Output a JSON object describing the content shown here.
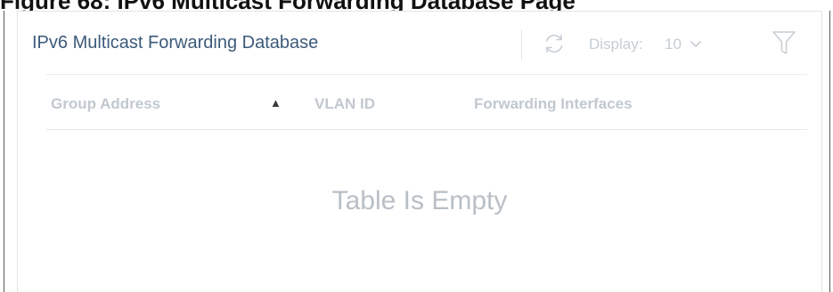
{
  "page": {
    "title": "Figure 68: IPv6 Multicast Forwarding Database Page"
  },
  "panel": {
    "title": "IPv6 Multicast Forwarding Database",
    "refresh_icon": "refresh-icon",
    "display_label": "Display:",
    "display_value": "10",
    "display_chevron_icon": "chevron-down-icon",
    "filter_icon": "filter-icon"
  },
  "table": {
    "columns": [
      {
        "label": "Group Address",
        "sort_icon": "sort-ascending-icon",
        "sort_symbol": "▲"
      },
      {
        "label": "VLAN ID"
      },
      {
        "label": "Forwarding Interfaces"
      }
    ],
    "rows": [],
    "empty_text": "Table Is Empty"
  },
  "colors": {
    "title": "#3c5a7a",
    "muted": "#c2c8cf",
    "border": "#e4e4e4"
  }
}
